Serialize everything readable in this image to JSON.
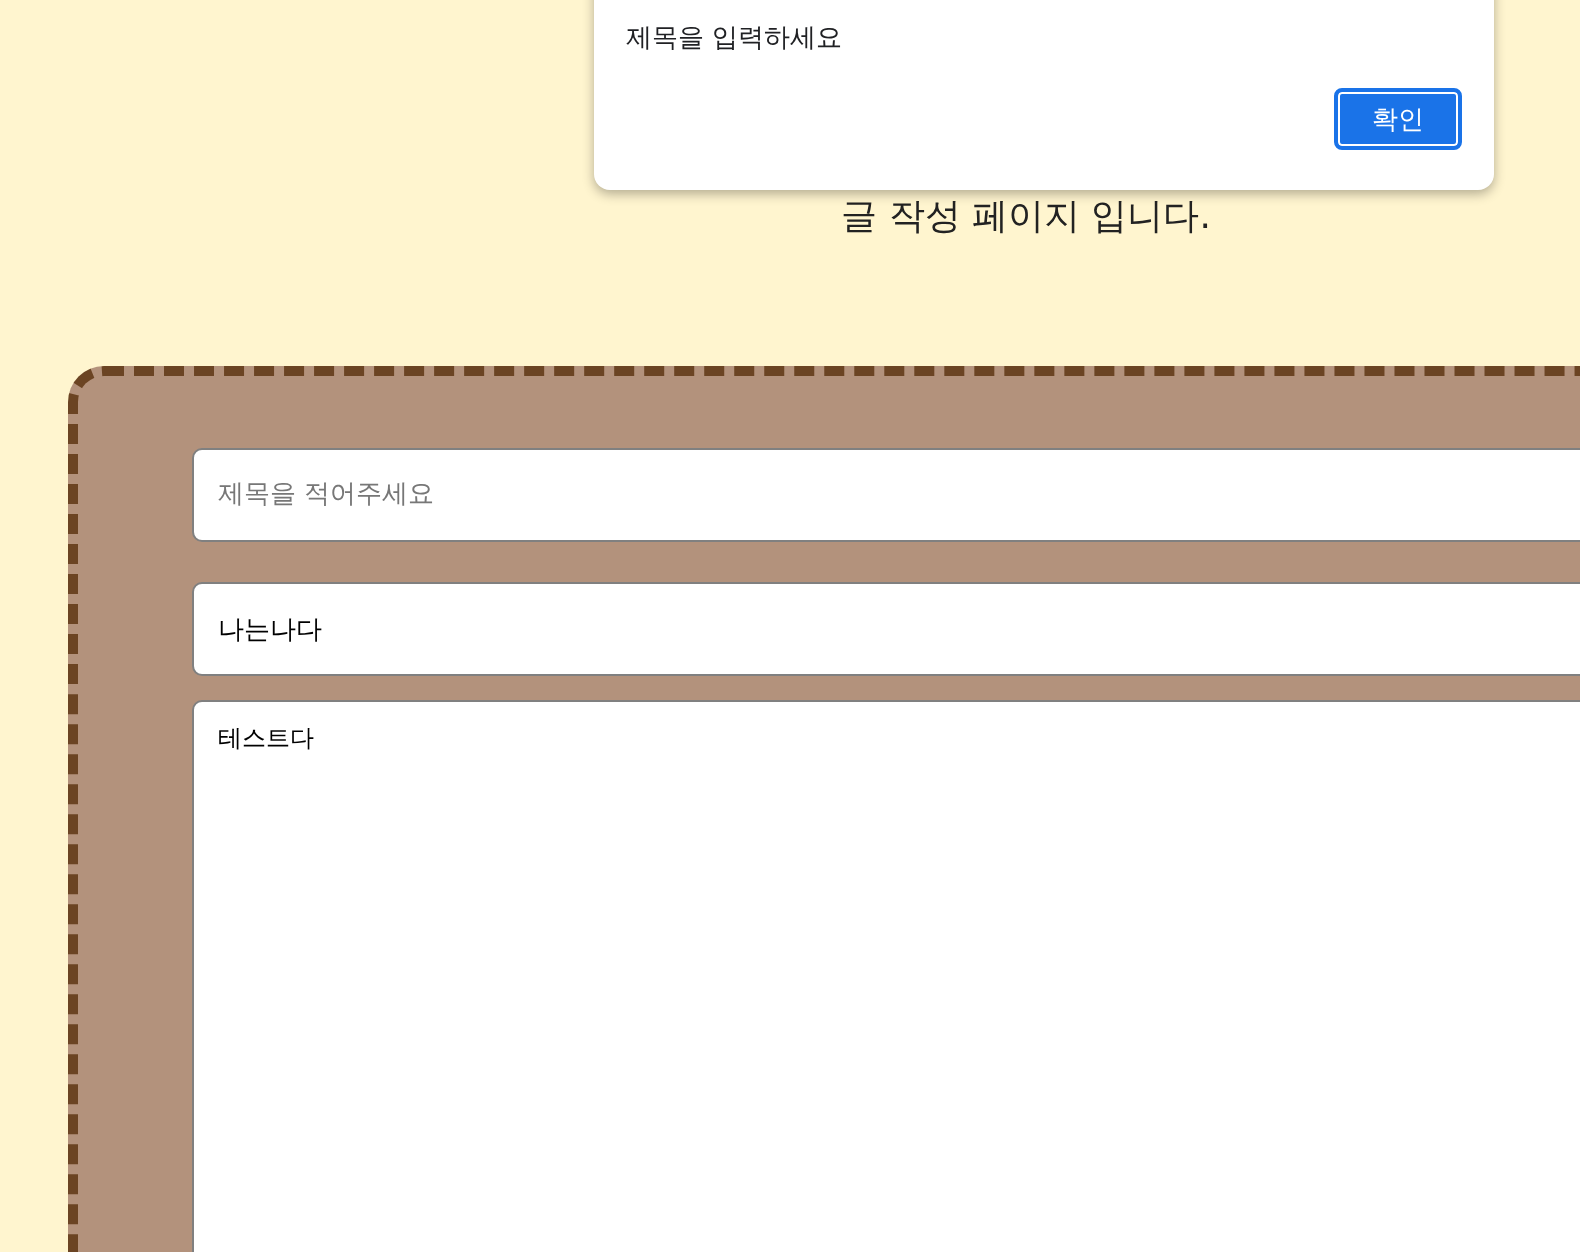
{
  "page_heading": "글 작성 페이지 입니다.",
  "form": {
    "title_field": {
      "placeholder": "제목을 적어주세요"
    },
    "author_field": {
      "value": "나는나다"
    },
    "content_field": {
      "value": "테스트다"
    }
  },
  "alert_dialog": {
    "message": "제목을 입력하세요",
    "button": "확인"
  }
}
